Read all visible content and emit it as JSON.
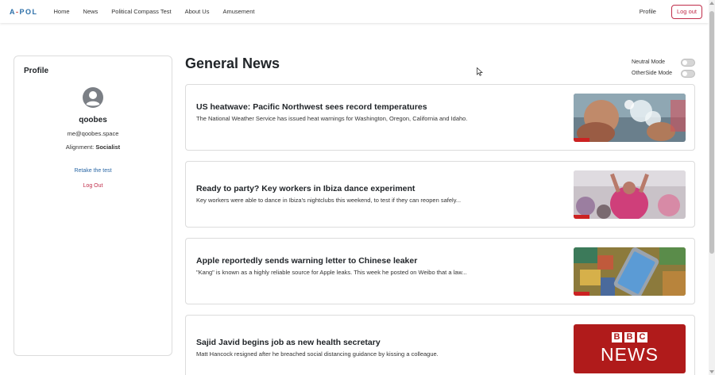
{
  "navbar": {
    "brand_a": "A",
    "brand_dash": "-",
    "brand_pol": "POL",
    "links": [
      "Home",
      "News",
      "Political Compass Test",
      "About Us",
      "Amusement"
    ],
    "profile_label": "Profile",
    "logout_label": "Log out"
  },
  "profile": {
    "heading": "Profile",
    "username": "qoobes",
    "email": "me@qoobes.space",
    "alignment_label": "Alignment:",
    "alignment_value": "Socialist",
    "retake_label": "Retake the test",
    "logout_label": "Log Out"
  },
  "main": {
    "title": "General News",
    "toggles": [
      {
        "label": "Neutral Mode",
        "on": false
      },
      {
        "label": "OtherSide Mode",
        "on": false
      }
    ],
    "articles": [
      {
        "title": "US heatwave: Pacific Northwest sees record temperatures",
        "description": "The National Weather Service has issued heat warnings for Washington, Oregon, California and Idaho.",
        "image": "heatwave-photo"
      },
      {
        "title": "Ready to party? Key workers in Ibiza dance experiment",
        "description": "Key workers were able to dance in Ibiza's nightclubs this weekend, to test if they can reopen safely...",
        "image": "party-photo"
      },
      {
        "title": "Apple reportedly sends warning letter to Chinese leaker",
        "description": "\"Kang\" is known as a highly reliable source for Apple leaks. This week he posted on Weibo that a law...",
        "image": "iphone-puzzle-photo"
      },
      {
        "title": "Sajid Javid begins job as new health secretary",
        "description": "Matt Hancock resigned after he breached social distancing guidance by kissing a colleague.",
        "image": "bbc-news-logo",
        "logo_top": "BBC",
        "logo_bottom": "NEWS"
      }
    ]
  },
  "colors": {
    "brand_blue": "#2c6fa8",
    "brand_red": "#d04a3f",
    "logout_red": "#c02d4a",
    "link_blue": "#2b68a6",
    "bbc_red": "#b01b1b"
  }
}
